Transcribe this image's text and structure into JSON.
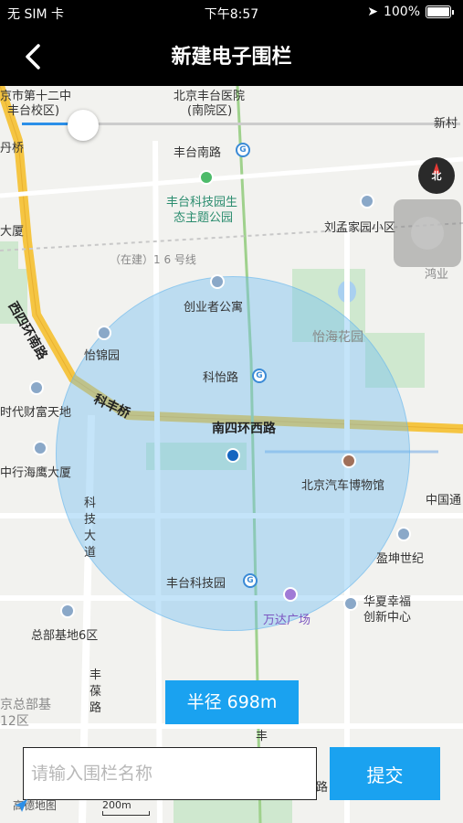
{
  "status_bar": {
    "carrier": "无 SIM 卡",
    "time": "下午8:57",
    "battery": "100%"
  },
  "nav": {
    "title": "新建电子围栏"
  },
  "map": {
    "labels": {
      "school": "京市第十二中",
      "school2": "丰台校区)",
      "hospital": "北京丰台医院",
      "hospital2": "(南院区)",
      "xincun": "新村",
      "danqiao": "丹桥",
      "fengtai_south_rd": "丰台南路",
      "park": "丰台科技园生",
      "park2": "态主题公园",
      "liumeng": "刘孟家园小区",
      "dasha": "大厦",
      "construction": "（在建）1 6 号线",
      "hongye": "鸿业",
      "xisihuan": "西四环南路",
      "chuangye": "创业者公寓",
      "yijin": "怡锦园",
      "yihai": "怡海花园",
      "keyi_rd": "科怡路",
      "kefeng_bridge": "科丰桥",
      "nansihuan": "南四环西路",
      "shidai": "时代财富天地",
      "zhonghang": "中行海鹰大厦",
      "auto_museum": "北京汽车博物馆",
      "zhongguo": "中国通",
      "keji_dadao": "科技大道",
      "yingkun": "盈坤世纪",
      "fengtai_park": "丰台科技园",
      "wanda": "万达广场",
      "huaxia": "华夏幸福",
      "huaxia2": "创新中心",
      "zongbu": "总部基地6区",
      "zongbu12": "京总部基",
      "zongbu12b": "12区",
      "fengbao": "丰葆路",
      "fengbao2": "丰",
      "lu": "路",
      "scale": "200m",
      "logo": "高德地图"
    },
    "slider_value": 0.14
  },
  "radius": {
    "label": "半径 698m"
  },
  "form": {
    "placeholder": "请输入围栏名称",
    "submit": "提交"
  },
  "compass": {
    "label": "北"
  }
}
